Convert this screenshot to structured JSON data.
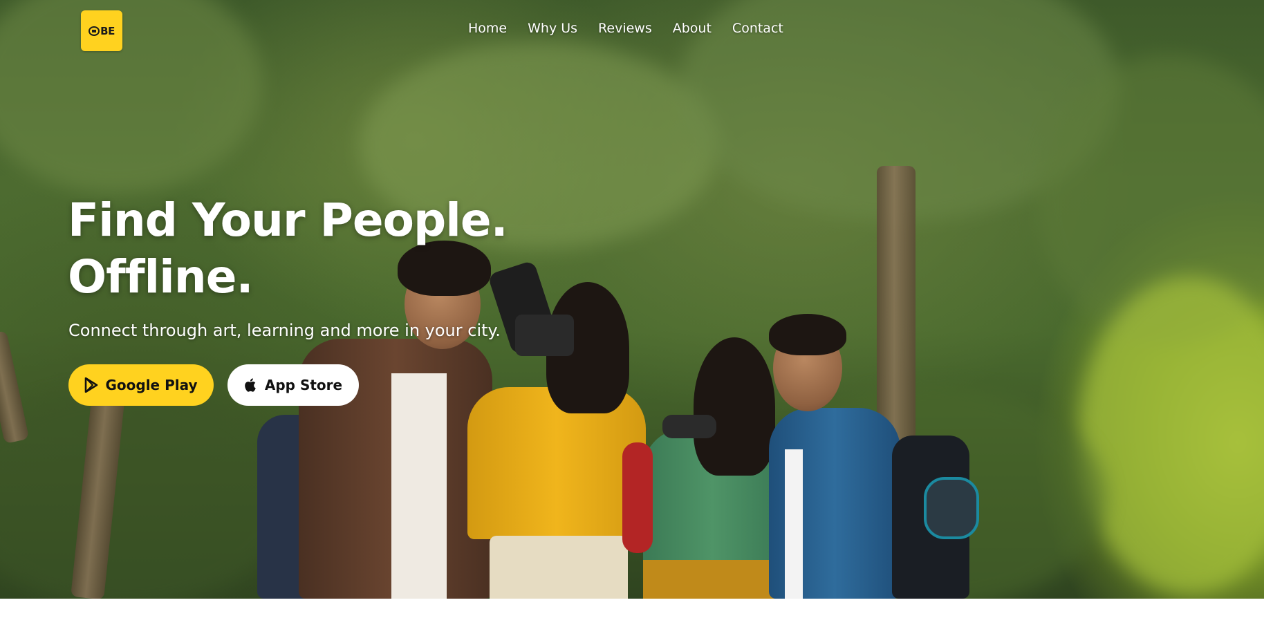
{
  "brand": {
    "logo_text": "BE",
    "logo_color": "#ffd21f"
  },
  "nav": {
    "items": [
      {
        "label": "Home"
      },
      {
        "label": "Why Us"
      },
      {
        "label": "Reviews"
      },
      {
        "label": "About"
      },
      {
        "label": "Contact"
      }
    ]
  },
  "hero": {
    "headline_line1": "Find Your People.",
    "headline_line2": "Offline.",
    "subheadline": "Connect through art, learning and more in your city.",
    "background_image": "group of four friends outdoors among trees, one holding a camera, one with binoculars",
    "buttons": {
      "google_play": {
        "label": "Google Play",
        "icon": "google-play-icon",
        "color": "#ffd21f"
      },
      "app_store": {
        "label": "App Store",
        "icon": "apple-icon",
        "color": "#ffffff"
      }
    }
  }
}
